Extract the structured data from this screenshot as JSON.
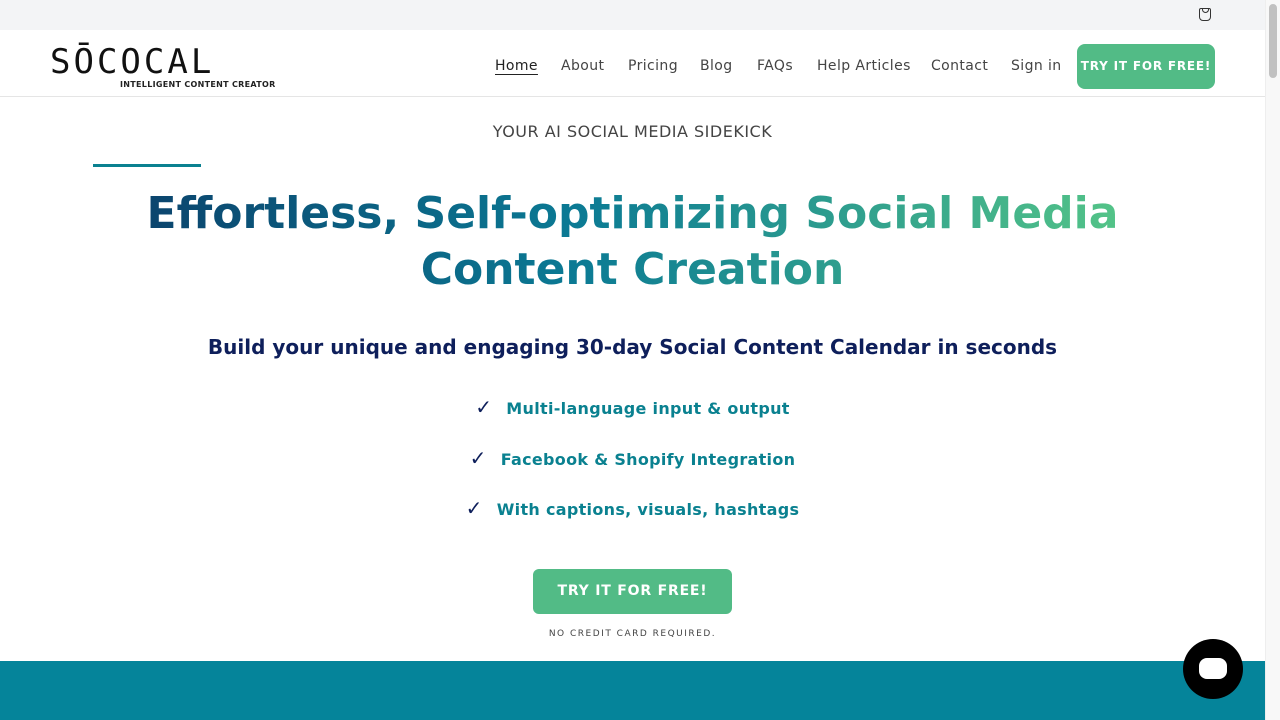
{
  "header": {
    "logo_text": "SŌCOCAL",
    "logo_tagline": "INTELLIGENT CONTENT CREATOR",
    "nav": [
      "Home",
      "About",
      "Pricing",
      "Blog",
      "FAQs",
      "Help Articles",
      "Contact",
      "Sign in"
    ],
    "cta": "TRY IT FOR FREE!"
  },
  "hero": {
    "eyebrow": "YOUR AI SOCIAL MEDIA SIDEKICK",
    "title": "Effortless, Self-optimizing Social Media Content Creation",
    "subtitle": "Build your unique and engaging 30-day Social Content Calendar in seconds",
    "features": [
      "Multi-language input & output",
      "Facebook & Shopify Integration",
      "With captions, visuals, hashtags"
    ],
    "cta": "TRY IT FOR FREE!",
    "note": "NO CREDIT CARD REQUIRED."
  },
  "colors": {
    "accent": "#52bb86",
    "teal": "#05849a",
    "navy": "#0e1f5b"
  }
}
